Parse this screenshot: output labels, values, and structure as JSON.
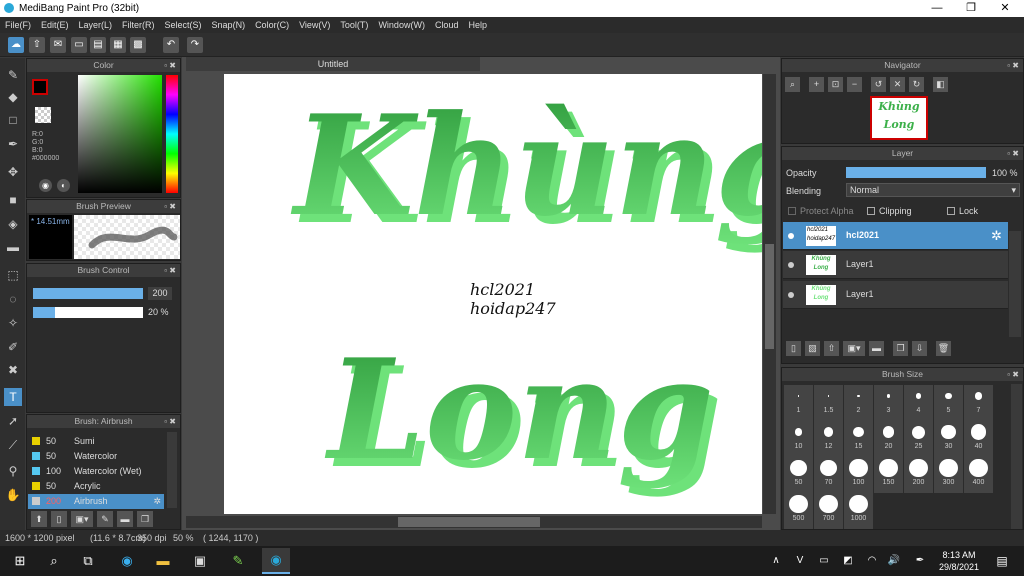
{
  "window": {
    "title": "MediBang Paint Pro (32bit)",
    "minimize": "—",
    "maximize": "❐",
    "close": "✕"
  },
  "menu": [
    "File(F)",
    "Edit(E)",
    "Layer(L)",
    "Filter(R)",
    "Select(S)",
    "Snap(N)",
    "Color(C)",
    "View(V)",
    "Tool(T)",
    "Window(W)",
    "Cloud",
    "Help"
  ],
  "panels": {
    "color": "Color",
    "brush_preview": "Brush Preview",
    "brush_control": "Brush Control",
    "brush_list": "Brush: Airbrush",
    "navigator": "Navigator",
    "layer": "Layer",
    "brush_size": "Brush Size"
  },
  "color": {
    "r": "R:0",
    "g": "G:0",
    "b": "B:0",
    "hex": "#000000",
    "fg": "#000000",
    "bg": "#ffffff",
    "accent": "#cc0000"
  },
  "brush_preview": {
    "size": "14.51mm"
  },
  "brush_control": {
    "size": "200",
    "opacity": "20 %",
    "size_fill": 1.0,
    "opacity_fill": 0.2
  },
  "brushes": [
    {
      "size": "50",
      "name": "Sumi",
      "color": "#e8d000"
    },
    {
      "size": "50",
      "name": "Watercolor",
      "color": "#55c8f0"
    },
    {
      "size": "100",
      "name": "Watercolor (Wet)",
      "color": "#55c8f0"
    },
    {
      "size": "50",
      "name": "Acrylic",
      "color": "#e8d000"
    },
    {
      "size": "200",
      "name": "Airbrush",
      "color": "#cccccc",
      "selected": true
    }
  ],
  "canvas": {
    "tab": "Untitled",
    "word1": "Khùng",
    "word2": "Long",
    "signature1": "hcl2021",
    "signature2": "hoidap247",
    "green_dark": "#2e9a3c",
    "green_light": "#6ee27a"
  },
  "layer": {
    "opacity_label": "Opacity",
    "opacity_value": "100 %",
    "blending_label": "Blending",
    "blending_value": "Normal",
    "protect_alpha": "Protect Alpha",
    "clipping": "Clipping",
    "lock": "Lock",
    "layers": [
      {
        "name": "hcl2021",
        "selected": true
      },
      {
        "name": "Layer1",
        "selected": false
      },
      {
        "name": "Layer1",
        "selected": false
      }
    ]
  },
  "brush_sizes": [
    "1",
    "1.5",
    "2",
    "3",
    "4",
    "5",
    "7",
    "10",
    "12",
    "15",
    "20",
    "25",
    "30",
    "40",
    "50",
    "70",
    "100",
    "150",
    "200",
    "300",
    "400",
    "500",
    "700",
    "1000"
  ],
  "status": {
    "dimensions": "1600 * 1200 pixel",
    "physical": "(11.6 * 8.7cm)",
    "dpi": "350 dpi",
    "zoom": "50 %",
    "coords": "( 1244, 1170 )"
  },
  "taskbar": {
    "time": "8:13 AM",
    "date": "29/8/2021"
  }
}
